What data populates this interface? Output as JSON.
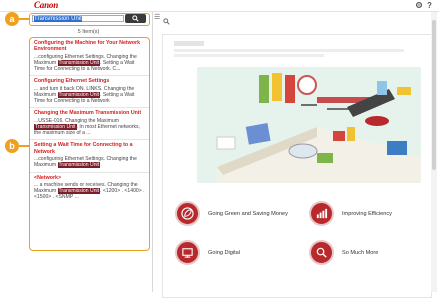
{
  "app": {
    "brand": "Canon",
    "settings_icon": "gear-icon",
    "help_icon": "help-icon"
  },
  "search": {
    "query": "Transmission Unit",
    "button_icon": "search-icon"
  },
  "results_count": "5 Item(s)",
  "results": [
    {
      "title": "Configuring the Machine for Your Network Environment",
      "pre": "...configuring Ethernet Settings. Changing the Maximum ",
      "hl": "Transmission Unit",
      "post": ". Setting a Wait Time for Connecting to a Network. C..."
    },
    {
      "title": "Configuring Ethernet Settings",
      "pre": "... and turn it back ON. LINKS. Changing the Maximum ",
      "hl": "Transmission Unit",
      "post": ". Setting a Wait Time for Connecting to a Network"
    },
    {
      "title": "Changing the Maximum Transmission Unit",
      "pre": "...USSE-016. Changing the Maximum ",
      "hl": "Transmission Unit",
      "post": ". In most Ethernet networks, the maximum size of a ..."
    },
    {
      "title": "Setting a Wait Time for Connecting to a Network",
      "pre": "...configuring Ethernet Settings. Changing the Maximum ",
      "hl": "Transmission Unit",
      "post": ""
    },
    {
      "title": "<Network>",
      "pre": "... a machine sends or receives. Changing the Maximum ",
      "hl": "Transmission Unit",
      "post": ". <1200> . <1400> . <1500> . <SNMP ..."
    }
  ],
  "callouts": {
    "a": "a",
    "b": "b"
  },
  "tiles": [
    {
      "label": "Going Green and Saving Money",
      "icon": "leaf-icon"
    },
    {
      "label": "Improving Efficiency",
      "icon": "chart-icon"
    },
    {
      "label": "Going Digital",
      "icon": "monitor-icon"
    },
    {
      "label": "So Much More",
      "icon": "magnifier-icon"
    }
  ],
  "colors": {
    "accent": "#f0a020",
    "brand_red": "#cc0000",
    "highlight": "#7a1e2a",
    "tile_red": "#b8282c"
  }
}
